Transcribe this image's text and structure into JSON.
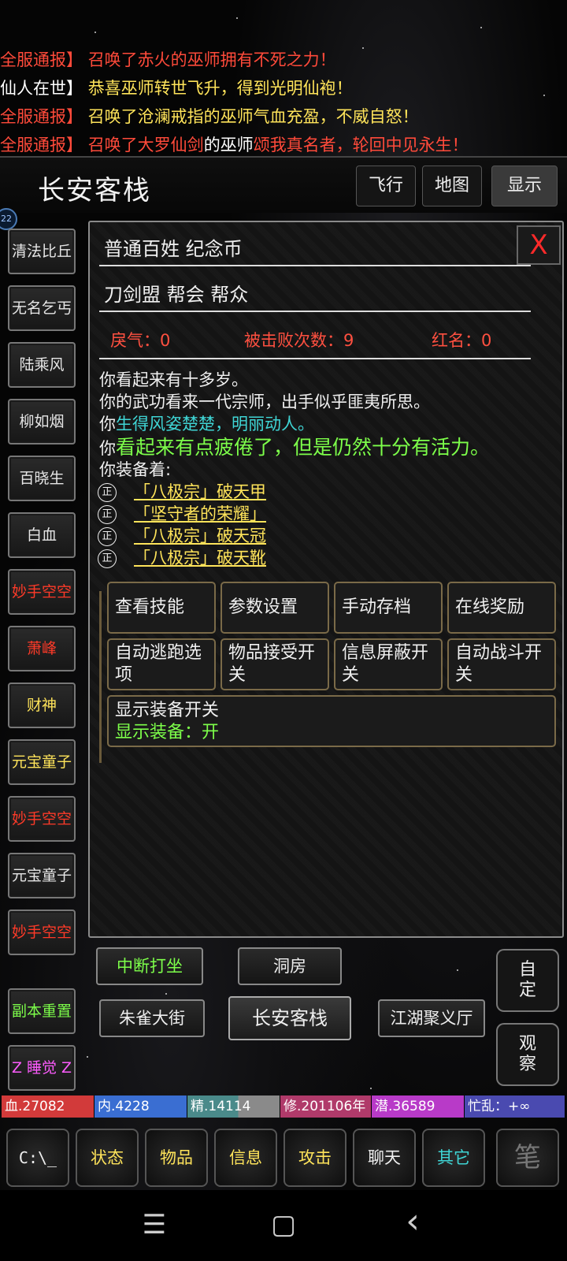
{
  "notices": [
    {
      "prefix": "全服通报】",
      "text": "召唤了赤火的巫师拥有不死之力！"
    },
    {
      "prefix": "仙人在世】",
      "text": "恭喜巫师转世飞升，得到光明仙袍！"
    },
    {
      "prefix": "全服通报】",
      "text": "召唤了沧澜戒指的巫师气血充盈，不威自怒！"
    },
    {
      "prefix": "全服通报】",
      "text_a": "召唤了大罗仙剑",
      "text_b": "的巫师",
      "text_c": "颂我真名者，轮回中见永生！"
    }
  ],
  "header": {
    "location": "长安客栈",
    "buttons": [
      "飞行",
      "地图",
      "显示"
    ]
  },
  "npcs": [
    "清法比丘",
    "无名乞丐",
    "陆乘风",
    "柳如烟",
    "百晓生",
    "白血",
    "妙手空空",
    "萧峰",
    "财神",
    "元宝童子",
    "妙手空空",
    "元宝童子",
    "妙手空空"
  ],
  "sidebar_actions": [
    "副本重置",
    "Z 睡觉 Z"
  ],
  "badge": "22",
  "panel": {
    "close": "X",
    "title_line": "普通百姓 纪念币",
    "guild_line": "刀剑盟 帮会 帮众",
    "separator": "——————————————————————————",
    "stats": {
      "qi": "戾气：0",
      "defeats": "被击败次数：9",
      "redname": "红名：0"
    },
    "desc1": "你看起来有十多岁。",
    "desc2": "你的武功看来一代宗师，出手似乎匪夷所思。",
    "desc3_a": "你",
    "desc3_b": "生得风姿楚楚，明丽动人。",
    "desc4_a": "你",
    "desc4_b": "看起来有点疲倦了，但是仍然十分有活力。",
    "equip_label": "你装备着:",
    "equip_icon": "正",
    "equipment": [
      "「八极宗」破天甲",
      "「坚守者的荣耀」",
      "「八极宗」破天冠",
      "「八极宗」破天靴"
    ],
    "actions": [
      "查看技能",
      "参数设置",
      "手动存档",
      "在线奖励",
      "自动逃跑选项",
      "物品接受开关",
      "信息屏蔽开关",
      "自动战斗开关"
    ],
    "equip_toggle_title": "显示装备开关",
    "equip_toggle_state": "显示装备：开"
  },
  "nav": {
    "meditate": "中断打坐",
    "north": "洞房",
    "west": "朱雀大街",
    "current": "长安客栈",
    "east": "江湖聚义厅",
    "custom": "自定",
    "observe": "观察"
  },
  "status_bar": {
    "hp": "血.27082",
    "mp": "内.4228",
    "jing": "精.14114",
    "xiu": "修.201106年",
    "qian": "潜.36589",
    "busy": "忙乱：+∞",
    "colors": {
      "hp": "#d23a3a",
      "mp": "#3a6ed2",
      "jing": "#4a8a8a",
      "xiu": "#b03a6a",
      "qian": "#b83ac8",
      "busy": "#4a4ab0"
    }
  },
  "menu": {
    "console": "C:\\_",
    "items": [
      "状态",
      "物品",
      "信息",
      "攻击",
      "聊天",
      "其它"
    ],
    "last": "笔"
  },
  "system_nav": {
    "menu": "☰",
    "home": "▢",
    "back": "‹"
  }
}
